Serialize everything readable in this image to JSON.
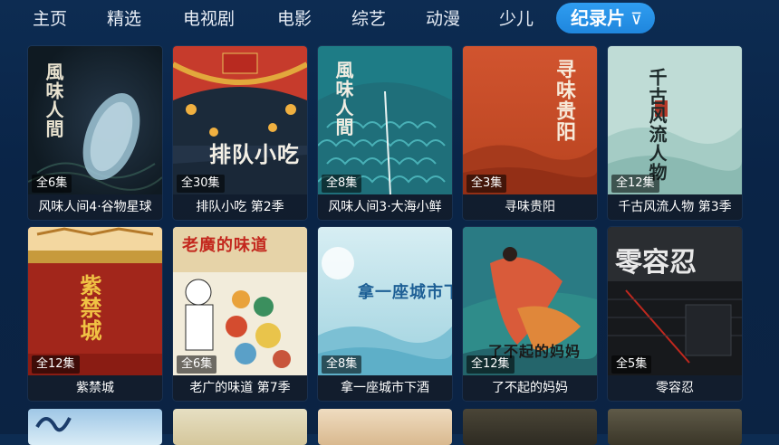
{
  "nav": {
    "tabs": [
      {
        "label": "主页"
      },
      {
        "label": "精选"
      },
      {
        "label": "电视剧"
      },
      {
        "label": "电影"
      },
      {
        "label": "综艺"
      },
      {
        "label": "动漫"
      },
      {
        "label": "少儿"
      },
      {
        "label": "纪录片"
      }
    ],
    "active_index": 7,
    "filter_icon": "filter-icon"
  },
  "cards": [
    {
      "title": "风味人间4·谷物星球",
      "episodes": "全6集",
      "poster_text": "風味人間"
    },
    {
      "title": "排队小吃 第2季",
      "episodes": "全30集",
      "poster_text": "排队小吃"
    },
    {
      "title": "风味人间3·大海小鲜",
      "episodes": "全8集",
      "poster_text": "風味人間"
    },
    {
      "title": "寻味贵阳",
      "episodes": "全3集",
      "poster_text": "寻味贵阳"
    },
    {
      "title": "千古风流人物 第3季",
      "episodes": "全12集",
      "poster_text": "千古风流人物"
    },
    {
      "title": "紫禁城",
      "episodes": "全12集",
      "poster_text": "紫禁城"
    },
    {
      "title": "老广的味道 第7季",
      "episodes": "全6集",
      "poster_text": "老廣的味道"
    },
    {
      "title": "拿一座城市下酒",
      "episodes": "全8集",
      "poster_text": "拿一座城市下酒"
    },
    {
      "title": "了不起的妈妈",
      "episodes": "全12集",
      "poster_text": "了不起的妈妈"
    },
    {
      "title": "零容忍",
      "episodes": "全5集",
      "poster_text": "零容忍"
    }
  ],
  "colors": {
    "accent": "#2a94ea",
    "background": "#0b2546"
  }
}
